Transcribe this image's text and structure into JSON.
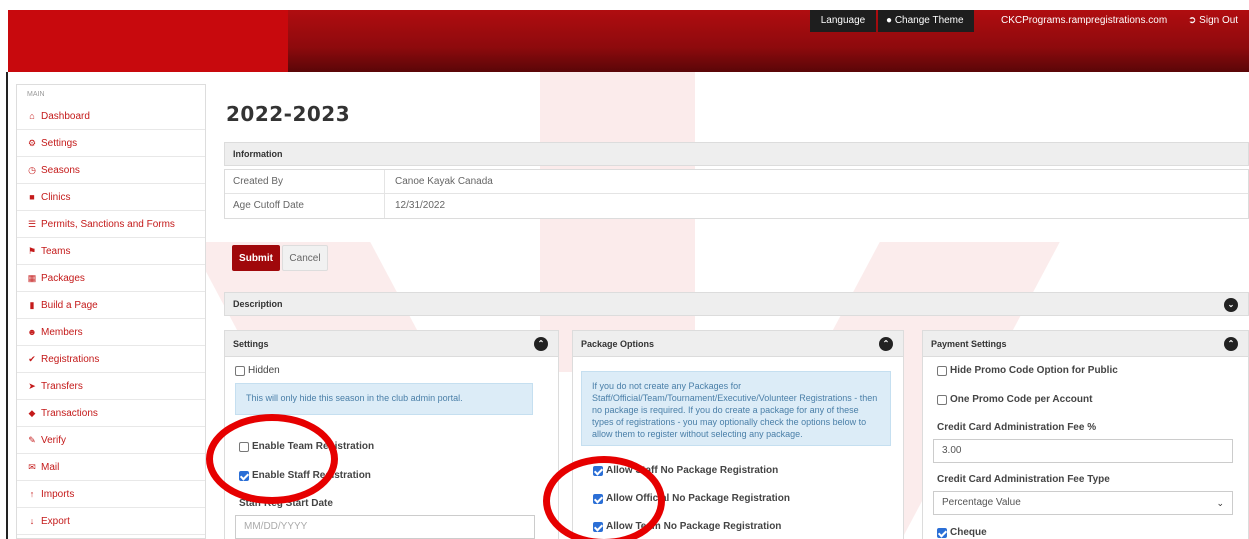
{
  "header": {
    "language": "Language",
    "change_theme": "Change Theme",
    "site": "CKCPrograms.rampregistrations.com",
    "sign_out": "Sign Out"
  },
  "sidebar": {
    "section": "MAIN",
    "items": [
      {
        "label": "Dashboard",
        "icon": "home-icon"
      },
      {
        "label": "Settings",
        "icon": "gear-icon"
      },
      {
        "label": "Seasons",
        "icon": "clock-icon"
      },
      {
        "label": "Clinics",
        "icon": "book-icon"
      },
      {
        "label": "Permits, Sanctions and Forms",
        "icon": "list-icon"
      },
      {
        "label": "Teams",
        "icon": "flag-icon"
      },
      {
        "label": "Packages",
        "icon": "grid-icon"
      },
      {
        "label": "Build a Page",
        "icon": "file-icon"
      },
      {
        "label": "Members",
        "icon": "user-icon"
      },
      {
        "label": "Registrations",
        "icon": "check-circle-icon"
      },
      {
        "label": "Transfers",
        "icon": "plane-icon"
      },
      {
        "label": "Transactions",
        "icon": "tag-icon"
      },
      {
        "label": "Verify",
        "icon": "pencil-icon"
      },
      {
        "label": "Mail",
        "icon": "mail-icon"
      },
      {
        "label": "Imports",
        "icon": "arrow-up-icon"
      },
      {
        "label": "Export",
        "icon": "arrow-down-icon"
      }
    ]
  },
  "page": {
    "title": "2022-2023",
    "information_header": "Information",
    "info_rows": [
      {
        "key": "Created By",
        "value": "Canoe Kayak Canada"
      },
      {
        "key": "Age Cutoff Date",
        "value": "12/31/2022"
      }
    ],
    "submit": "Submit",
    "cancel": "Cancel",
    "description_header": "Description"
  },
  "settings": {
    "header": "Settings",
    "hidden_label": "Hidden",
    "hidden_note": "This will only hide this season in the club admin portal.",
    "enable_team_reg": "Enable Team Registration",
    "enable_staff_reg": "Enable Staff Registration",
    "staff_reg_start_label": "Staff Reg Start Date",
    "staff_reg_start_placeholder": "MM/DD/YYYY"
  },
  "package_options": {
    "header": "Package Options",
    "note": "If you do not create any Packages for Staff/Official/Team/Tournament/Executive/Volunteer Registrations - then no package is required. If you do create a package for any of these types of registrations - you may optionally check the options below to allow them to register without selecting any package.",
    "allow_staff": "Allow Staff No Package Registration",
    "allow_official": "Allow Official No Package Registration",
    "allow_team": "Allow Team No Package Registration"
  },
  "payment": {
    "header": "Payment Settings",
    "hide_promo": "Hide Promo Code Option for Public",
    "one_promo": "One Promo Code per Account",
    "cc_fee_label": "Credit Card Administration Fee %",
    "cc_fee_value": "3.00",
    "cc_fee_type_label": "Credit Card Administration Fee Type",
    "cc_fee_type_value": "Percentage Value",
    "cheque": "Cheque"
  },
  "colors": {
    "brand_red": "#a0080b",
    "header_red": "#c8090d",
    "annotation_red": "#e60000",
    "sidebar_link": "#c41a1a"
  }
}
